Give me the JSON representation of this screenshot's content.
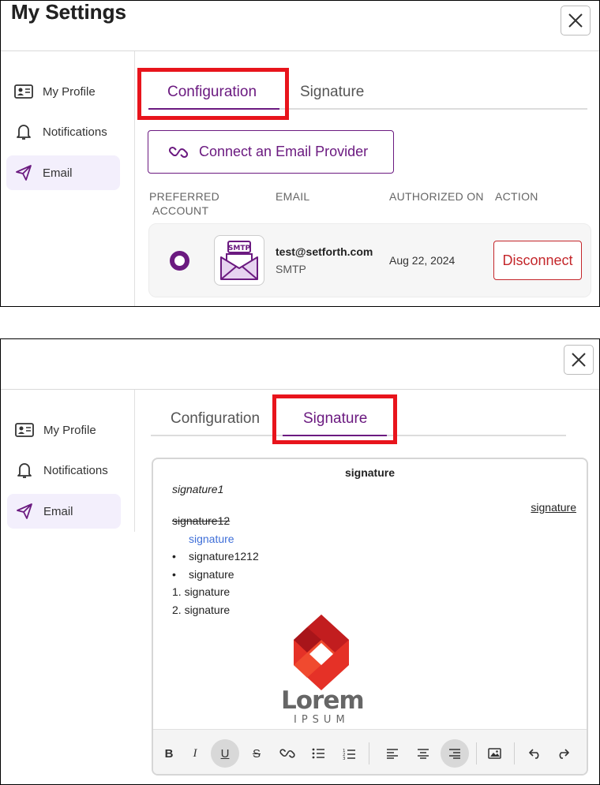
{
  "settings": {
    "title": "My Settings",
    "nav": [
      {
        "label": "My Profile",
        "icon": "id-card-icon"
      },
      {
        "label": "Notifications",
        "icon": "bell-icon"
      },
      {
        "label": "Email",
        "icon": "send-icon",
        "active": true
      }
    ],
    "tabs": [
      "Configuration",
      "Signature"
    ]
  },
  "config": {
    "connect_label": "Connect an Email Provider",
    "columns": {
      "preferred_line1": "PREFERRED",
      "preferred_line2": "ACCOUNT",
      "email": "EMAIL",
      "authorized": "AUTHORIZED ON",
      "action": "ACTION"
    },
    "account": {
      "badge": "SMTP",
      "email": "test@setforth.com",
      "type": "SMTP",
      "authorized_on": "Aug 22, 2024",
      "action_label": "Disconnect"
    }
  },
  "signature": {
    "heading": "signature",
    "italic_line": "signature1",
    "right_link": "signature",
    "strike_line": "signature12",
    "blue_line": "signature",
    "bullets": [
      "signature1212",
      "signature"
    ],
    "numbered": [
      "1. signature",
      "2. signature"
    ],
    "logo_word": "Lorem",
    "logo_sub": "IPSUM",
    "toolbar": [
      "B",
      "I",
      "U",
      "S"
    ]
  },
  "colors": {
    "accent": "#6b1a80",
    "danger": "#c4272b",
    "highlight": "#e8141c",
    "link_blue": "#3f6fd8"
  }
}
